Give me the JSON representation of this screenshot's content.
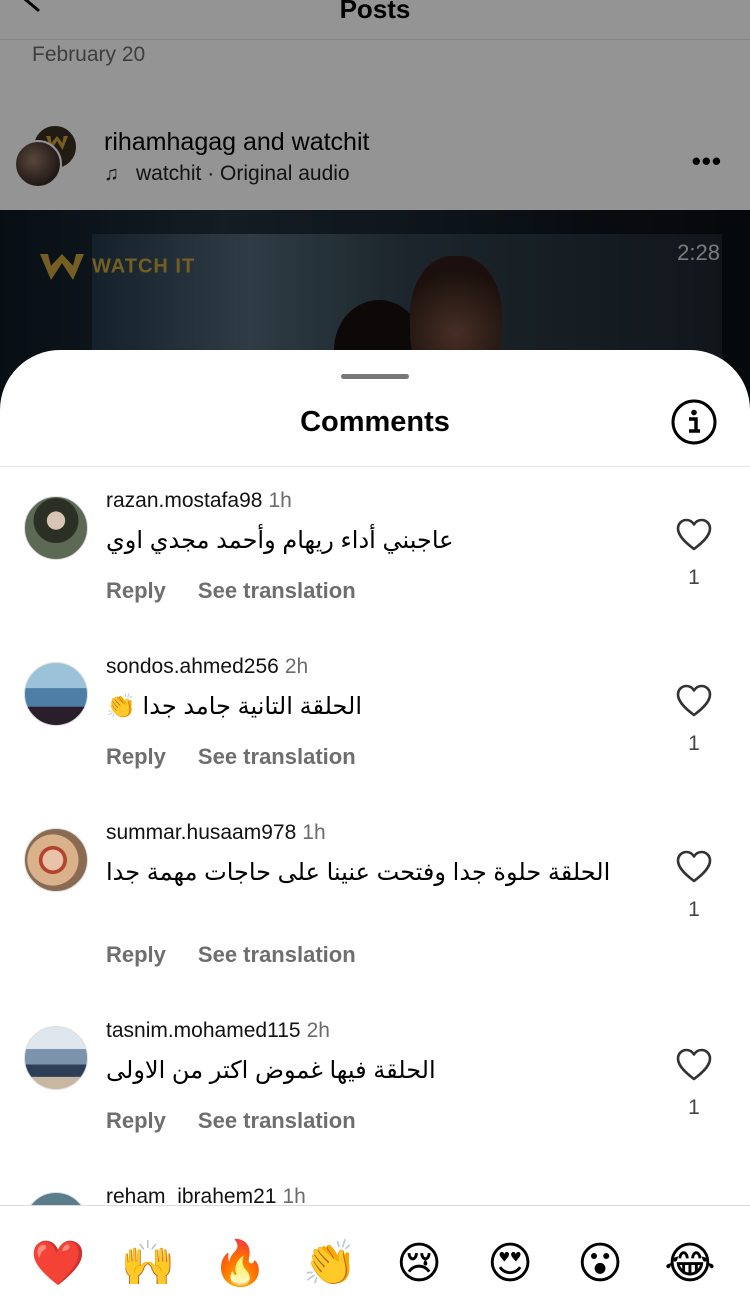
{
  "background": {
    "title": "Posts",
    "date": "February 20",
    "post_user_1": "rihamhagag",
    "post_and": "and",
    "post_user_2": "watchit",
    "audio_label": "watchit · Original audio",
    "video_logo": "WATCH IT",
    "video_time": "2:28"
  },
  "sheet": {
    "title": "Comments"
  },
  "comments": [
    {
      "username": "razan.mostafa98",
      "time": "1h",
      "text": "عاجبني أداء ريهام وأحمد مجدي اوي",
      "reply": "Reply",
      "translate": "See translation",
      "likes": "1"
    },
    {
      "username": "sondos.ahmed256",
      "time": "2h",
      "text": "الحلقة التانية جامد جدا 👏",
      "reply": "Reply",
      "translate": "See translation",
      "likes": "1"
    },
    {
      "username": "summar.husaam978",
      "time": "1h",
      "text": "الحلقة حلوة جدا وفتحت عنينا على حاجات مهمة جدا",
      "reply": "Reply",
      "translate": "See translation",
      "likes": "1"
    },
    {
      "username": "tasnim.mohamed115",
      "time": "2h",
      "text": "الحلقة فيها غموض اكتر من الاولى",
      "reply": "Reply",
      "translate": "See translation",
      "likes": "1"
    },
    {
      "username": "reham_ibrahem21",
      "time": "1h"
    }
  ],
  "emoji_bar": [
    "❤️",
    "🙌",
    "🔥",
    "👏",
    "😢",
    "😍",
    "😮",
    "😂"
  ],
  "colors": {
    "heart": "#e2222e",
    "secondary_text": "#6e6e6e",
    "dim_overlay": "rgba(0,0,0,0.42)"
  }
}
